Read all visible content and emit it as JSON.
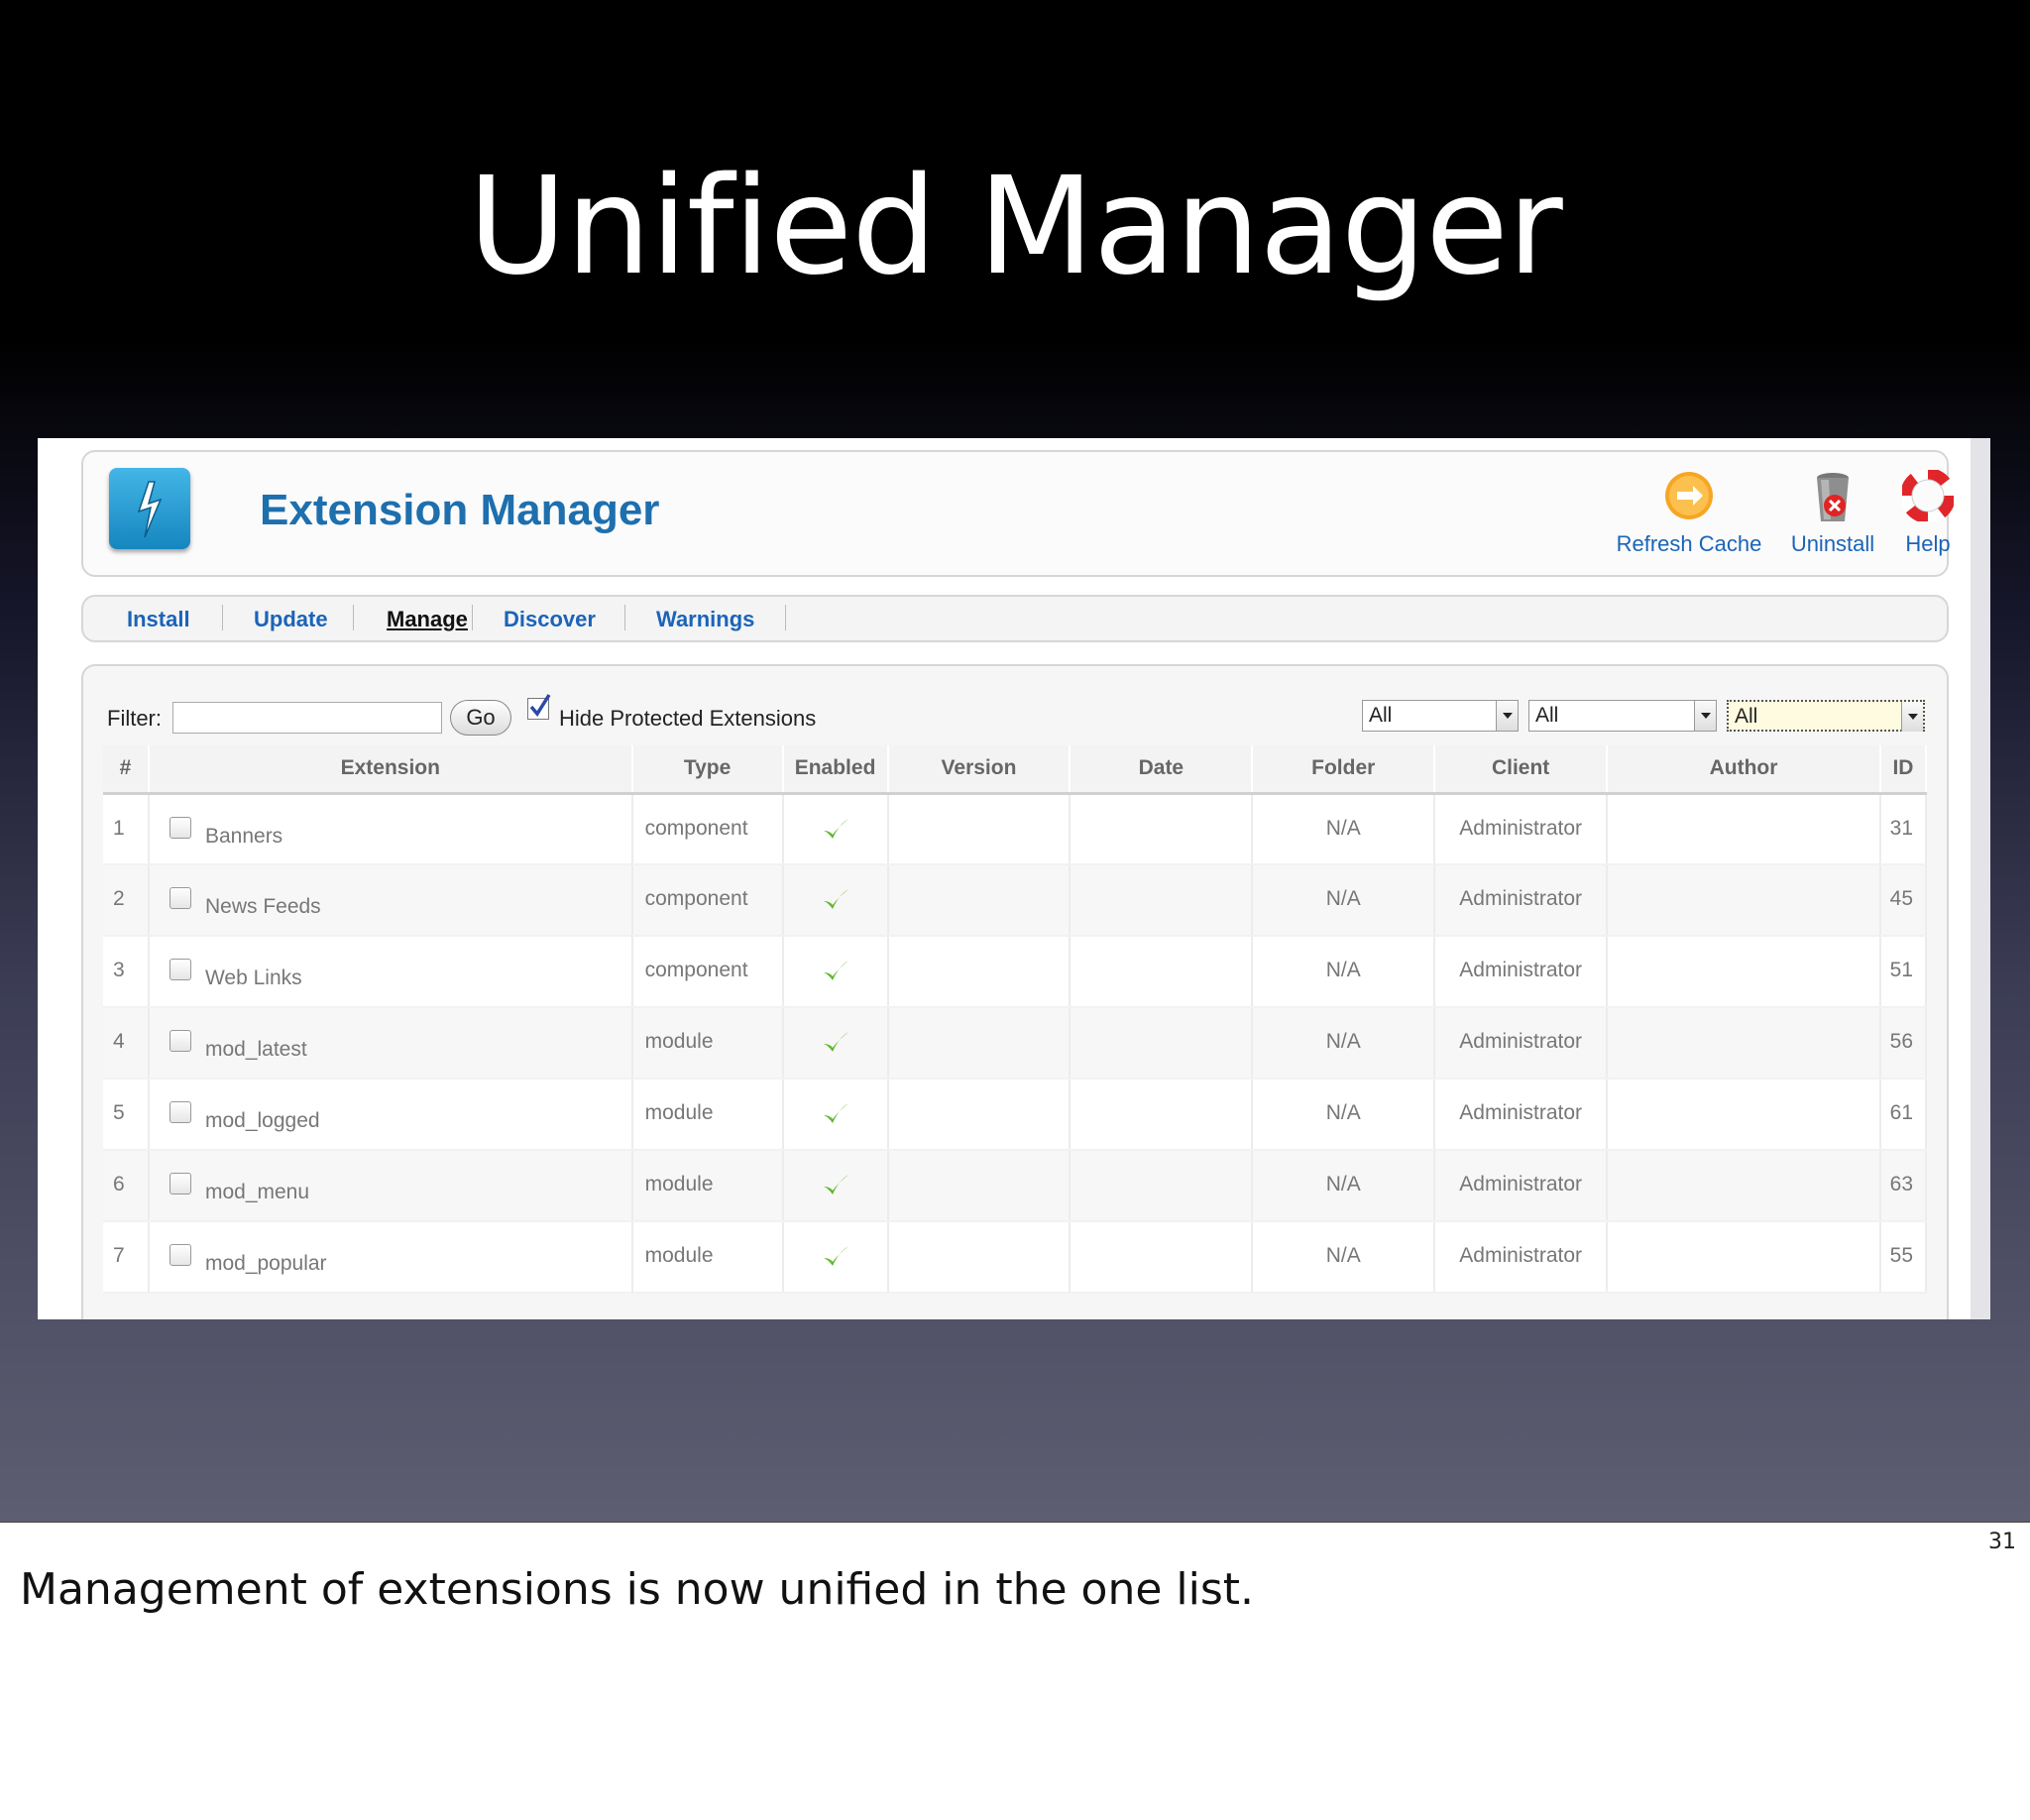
{
  "slide": {
    "title": "Unified Manager",
    "number": "31",
    "notes": "Management of extensions is now unified in the one list."
  },
  "app": {
    "title": "Extension Manager",
    "toolbar": [
      {
        "label": "Refresh Cache",
        "icon": "refresh-icon"
      },
      {
        "label": "Uninstall",
        "icon": "trash-icon"
      },
      {
        "label": "Help",
        "icon": "lifebuoy-icon"
      }
    ],
    "tabs": [
      {
        "label": "Install",
        "active": false
      },
      {
        "label": "Update",
        "active": false
      },
      {
        "label": "Manage",
        "active": true
      },
      {
        "label": "Discover",
        "active": false
      },
      {
        "label": "Warnings",
        "active": false
      }
    ]
  },
  "filter": {
    "label": "Filter:",
    "value": "",
    "go_label": "Go",
    "hide_protected_label": "Hide Protected Extensions",
    "hide_protected_checked": true,
    "selects": [
      "All",
      "All",
      "All"
    ]
  },
  "table": {
    "headers": [
      "#",
      "Extension",
      "Type",
      "Enabled",
      "Version",
      "Date",
      "Folder",
      "Client",
      "Author",
      "ID"
    ],
    "rows": [
      {
        "num": "1",
        "name": "Banners",
        "type": "component",
        "enabled": true,
        "version": "",
        "date": "",
        "folder": "N/A",
        "client": "Administrator",
        "author": "",
        "id": "31"
      },
      {
        "num": "2",
        "name": "News Feeds",
        "type": "component",
        "enabled": true,
        "version": "",
        "date": "",
        "folder": "N/A",
        "client": "Administrator",
        "author": "",
        "id": "45"
      },
      {
        "num": "3",
        "name": "Web Links",
        "type": "component",
        "enabled": true,
        "version": "",
        "date": "",
        "folder": "N/A",
        "client": "Administrator",
        "author": "",
        "id": "51"
      },
      {
        "num": "4",
        "name": "mod_latest",
        "type": "module",
        "enabled": true,
        "version": "",
        "date": "",
        "folder": "N/A",
        "client": "Administrator",
        "author": "",
        "id": "56"
      },
      {
        "num": "5",
        "name": "mod_logged",
        "type": "module",
        "enabled": true,
        "version": "",
        "date": "",
        "folder": "N/A",
        "client": "Administrator",
        "author": "",
        "id": "61"
      },
      {
        "num": "6",
        "name": "mod_menu",
        "type": "module",
        "enabled": true,
        "version": "",
        "date": "",
        "folder": "N/A",
        "client": "Administrator",
        "author": "",
        "id": "63"
      },
      {
        "num": "7",
        "name": "mod_popular",
        "type": "module",
        "enabled": true,
        "version": "",
        "date": "",
        "folder": "N/A",
        "client": "Administrator",
        "author": "",
        "id": "55"
      }
    ]
  },
  "colors": {
    "link": "#1b64b8",
    "title": "#1e6fae",
    "check": "#5cb82e"
  }
}
